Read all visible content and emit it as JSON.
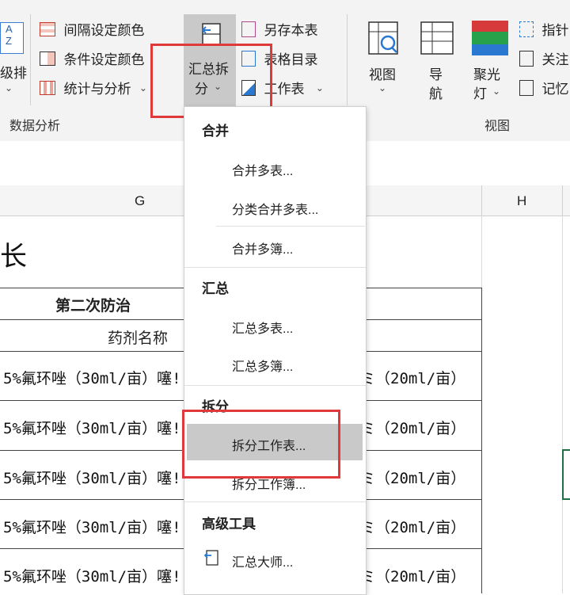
{
  "ribbon": {
    "sort_label_top": "A\nZ",
    "sort_label": "级排",
    "data_analysis": {
      "items": [
        "间隔设定颜色",
        "条件设定颜色",
        "统计与分析"
      ],
      "group_label": "数据分析"
    },
    "summary_split": {
      "line1": "汇总拆",
      "line2": "分"
    },
    "save_group": {
      "items": [
        "另存本表",
        "表格目录",
        "工作表"
      ]
    },
    "view_group": {
      "view": "视图",
      "nav_line1": "导",
      "nav_line2": "航",
      "spotlight_line1": "聚光",
      "spotlight_line2": "灯",
      "right_items": [
        "指针",
        "关注",
        "记忆"
      ],
      "group_label": "视图"
    }
  },
  "sheet": {
    "col_g": "G",
    "col_h": "H",
    "title_fragment": "长",
    "header1": "第二次防治",
    "header2": "药剂名称",
    "row_text": "5%氟环唑（30ml/亩）噻!",
    "row_right": "ミ（20ml/亩）",
    "rows_count": 5
  },
  "menu": {
    "sections": [
      {
        "header": "合并",
        "items": [
          "合并多表...",
          "分类合并多表...",
          "合并多簿..."
        ]
      },
      {
        "header": "汇总",
        "items": [
          "汇总多表...",
          "汇总多簿..."
        ]
      },
      {
        "header": "拆分",
        "items": [
          "拆分工作表...",
          "拆分工作簿..."
        ]
      },
      {
        "header": "高级工具",
        "items": [
          "汇总大师..."
        ]
      }
    ]
  },
  "colors": {
    "highlight_border": "#e0393b",
    "hover_bg": "#c9c9c9"
  }
}
